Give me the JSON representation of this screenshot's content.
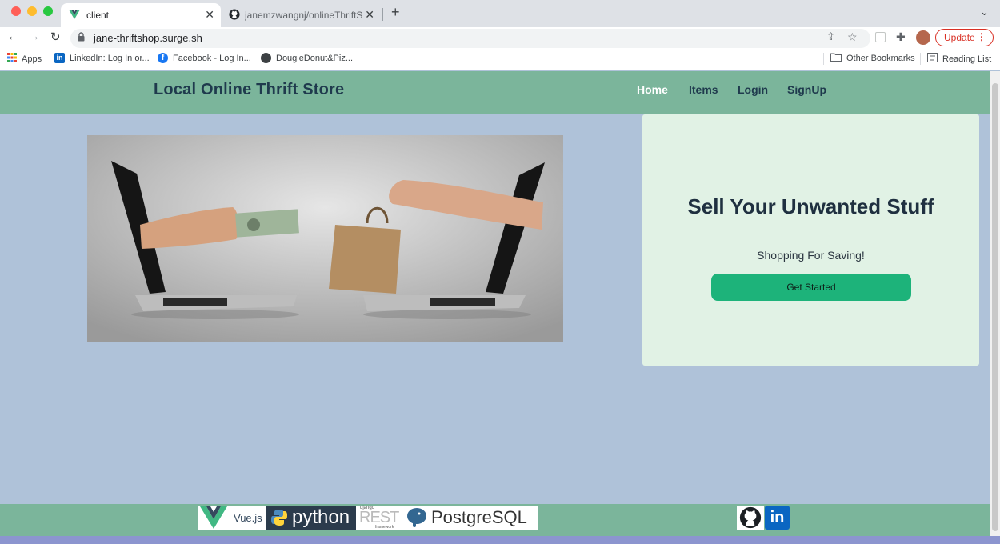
{
  "browser": {
    "tabs": [
      {
        "title": "client",
        "icon": "vue-icon",
        "active": true
      },
      {
        "title": "janemzwangnj/onlineThriftShop",
        "icon": "github-icon",
        "active": false
      }
    ],
    "address": "jane-thriftshop.surge.sh",
    "update_label": "Update",
    "bookmarks": [
      {
        "label": "Apps",
        "icon": "apps-grid-icon"
      },
      {
        "label": "LinkedIn: Log In or...",
        "icon": "linkedin-icon"
      },
      {
        "label": "Facebook - Log In...",
        "icon": "facebook-icon"
      },
      {
        "label": "DougieDonut&Piz...",
        "icon": "globe-icon"
      },
      {
        "label": "Other Bookmarks",
        "icon": "folder-icon"
      },
      {
        "label": "Reading List",
        "icon": "reading-list-icon"
      }
    ]
  },
  "site": {
    "brand": "Local Online Thrift Store",
    "nav": [
      {
        "label": "Home",
        "active": true
      },
      {
        "label": "Items",
        "active": false
      },
      {
        "label": "Login",
        "active": false
      },
      {
        "label": "SignUp",
        "active": false
      }
    ],
    "hero": {
      "heading": "Sell Your Unwanted Stuff",
      "subheading": "Shopping For Saving!",
      "cta_label": "Get Started"
    },
    "footer_logos": [
      {
        "label": "Vue.js",
        "icon": "vue-logo"
      },
      {
        "label": "python",
        "icon": "python-logo"
      },
      {
        "label": "django",
        "icon": "django-rest-logo"
      },
      {
        "label": "REST",
        "icon": "django-rest-logo"
      },
      {
        "label": "framework",
        "icon": "django-rest-logo"
      },
      {
        "label": "PostgreSQL",
        "icon": "postgresql-logo"
      }
    ],
    "social_icons": [
      "github-icon",
      "linkedin-icon"
    ]
  },
  "colors": {
    "page_bg": "#afc2d9",
    "navbar": "#7bb59b",
    "card": "#e1f2e5",
    "cta": "#1db37a"
  }
}
